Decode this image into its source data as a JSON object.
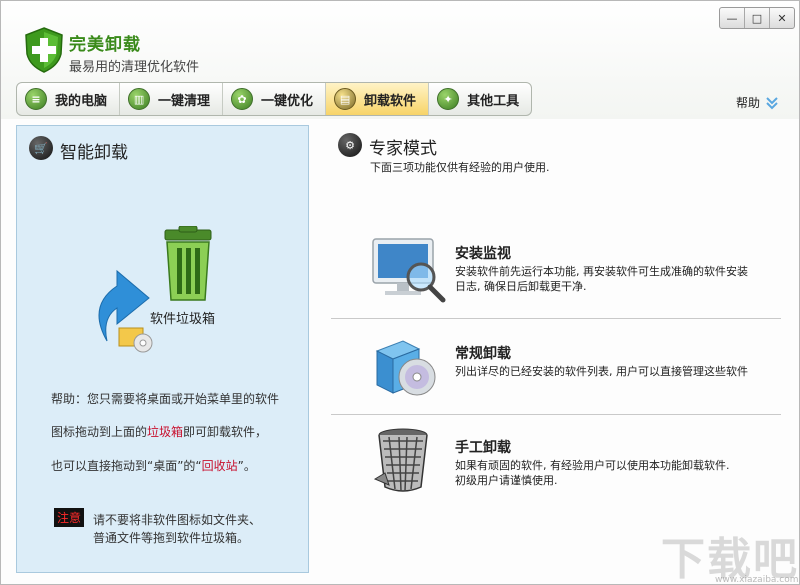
{
  "app": {
    "title": "完美卸载",
    "subtitle": "最易用的清理优化软件"
  },
  "window_controls": [
    "—",
    "□",
    "✕"
  ],
  "tabs": [
    {
      "label": "我的电脑",
      "icon": "document-icon"
    },
    {
      "label": "一键清理",
      "icon": "trash-icon"
    },
    {
      "label": "一键优化",
      "icon": "gear-icon"
    },
    {
      "label": "卸载软件",
      "icon": "uninstall-icon",
      "active": true
    },
    {
      "label": "其他工具",
      "icon": "pin-icon"
    }
  ],
  "help_label": "帮助",
  "left_panel": {
    "title": "智能卸载",
    "trash_label": "软件垃圾箱",
    "help_line1": "帮助：您只需要将桌面或开始菜单里的软件",
    "help_line2_a": "图标拖动到上面的",
    "help_line2_red": "垃圾箱",
    "help_line2_b": "即可卸载软件，",
    "help_line3_a": "也可以直接拖动到“桌面”的“",
    "help_line3_red": "回收站",
    "help_line3_b": "”。",
    "note_badge": "注意",
    "note_line1": "请不要将非软件图标如文件夹、",
    "note_line2": "普通文件等拖到软件垃圾箱。"
  },
  "right_panel": {
    "title": "专家模式",
    "subtitle": "下面三项功能仅供有经验的用户使用.",
    "items": [
      {
        "title": "安装监视",
        "desc1": "安装软件前先运行本功能, 再安装软件可生成准确的软件安装",
        "desc2": "日志, 确保日后卸载更干净."
      },
      {
        "title": "常规卸载",
        "desc1": "列出详尽的已经安装的软件列表, 用户可以直接管理这些软件",
        "desc2": ""
      },
      {
        "title": "手工卸载",
        "desc1": "如果有顽固的软件, 有经验用户可以使用本功能卸载软件.",
        "desc2": "初级用户请谨慎使用."
      }
    ]
  },
  "watermark": "下载吧",
  "watermark_url": "www.xiazaiba.com",
  "colors": {
    "brand_green": "#3a8a1a",
    "panel_bg": "#dcedf8",
    "active_tab": "#f7d468",
    "warning_red": "#c8102e"
  }
}
